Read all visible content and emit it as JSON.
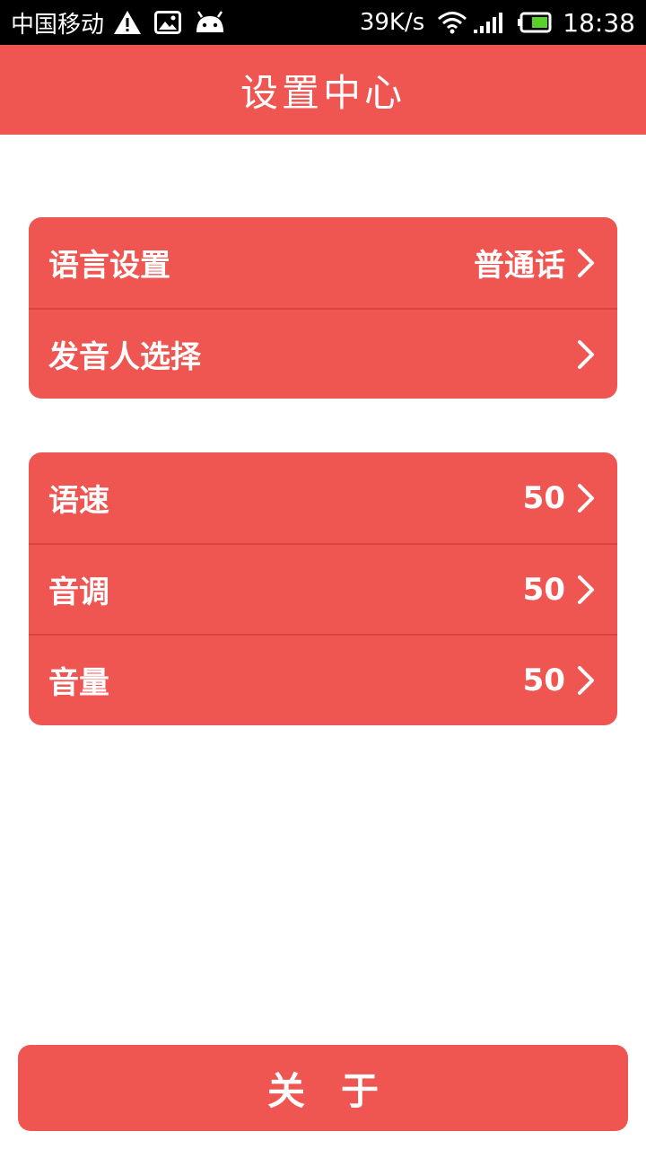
{
  "status_bar": {
    "carrier": "中国移动",
    "net_speed": "39K/s",
    "time": "18:38",
    "icons": [
      "warning-icon",
      "image-icon",
      "android-icon",
      "wifi-icon",
      "signal-icon",
      "battery-icon"
    ]
  },
  "header": {
    "title": "设置中心"
  },
  "group1": {
    "rows": [
      {
        "label": "语言设置",
        "value": "普通话"
      },
      {
        "label": "发音人选择",
        "value": ""
      }
    ]
  },
  "group2": {
    "rows": [
      {
        "label": "语速",
        "value": "50"
      },
      {
        "label": "音调",
        "value": "50"
      },
      {
        "label": "音量",
        "value": "50"
      }
    ]
  },
  "about_button": {
    "label": "关于"
  },
  "colors": {
    "accent": "#ef5652",
    "divider": "#dc4440",
    "status_bar": "#000000",
    "battery_fill": "#5ad12b"
  }
}
